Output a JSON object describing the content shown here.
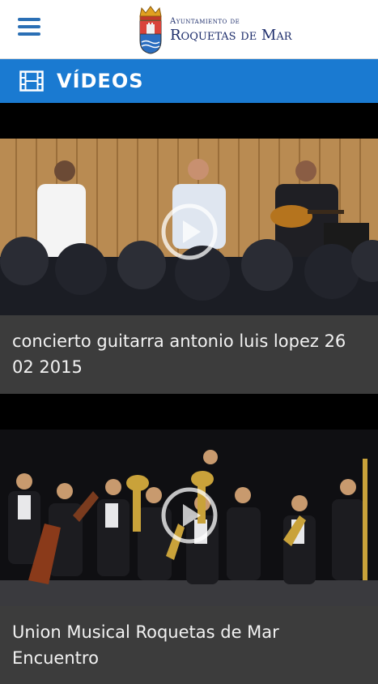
{
  "header": {
    "menu_icon": "hamburger-menu-icon",
    "logo_line1": "Ayuntamiento de",
    "logo_line2": "Roquetas de Mar",
    "crest_icon": "municipal-crest-icon"
  },
  "section": {
    "icon": "film-icon",
    "title": "VÍDEOS"
  },
  "videos": [
    {
      "title": "concierto guitarra antonio luis lopez 26 02 2015",
      "play_icon": "play-icon"
    },
    {
      "title": "Union Musical Roquetas de Mar Encuentro",
      "play_icon": "play-icon"
    }
  ],
  "colors": {
    "accent": "#1a7ad1",
    "menu": "#2a6fb5",
    "caption_bg": "#3c3c3c",
    "logo_text": "#1d2d6b"
  }
}
